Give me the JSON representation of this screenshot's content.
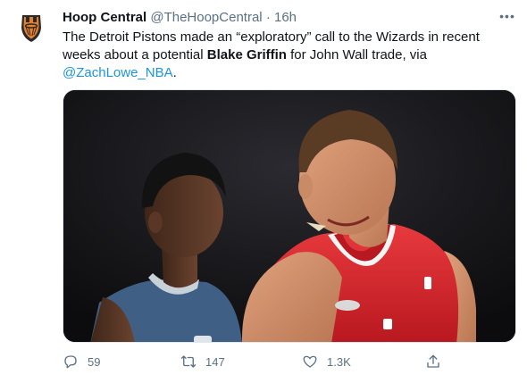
{
  "tweet": {
    "author_name": "Hoop Central",
    "author_handle": "@TheHoopCentral",
    "separator": "·",
    "time": "16h",
    "text_part1": "The Detroit Pistons made an “exploratory” call to the Wizards in recent weeks about a potential ",
    "text_bold": "Blake Griffin",
    "text_part2": " for John Wall trade, via ",
    "mention": "@ZachLowe_NBA",
    "text_end": ".",
    "more_icon": "more-horizontal-icon"
  },
  "stats": {
    "replies": "59",
    "retweets": "147",
    "likes": "1.3K"
  },
  "colors": {
    "link": "#1b95e0",
    "secondary": "#5b7083",
    "primary_text": "#0f1419",
    "clippers_red": "#d8282f",
    "wizards_blue": "#3f5f84",
    "logo_orange": "#e87f2c"
  },
  "icons": [
    "reply-icon",
    "retweet-icon",
    "like-icon",
    "share-icon"
  ]
}
